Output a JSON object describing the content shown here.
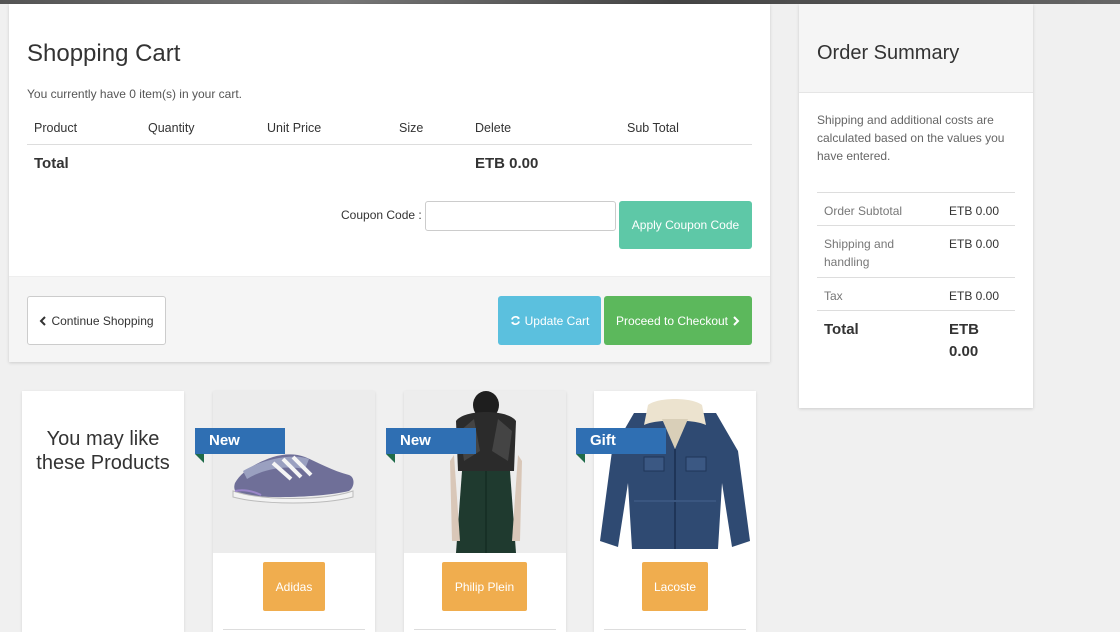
{
  "cart": {
    "title": "Shopping Cart",
    "note": "You currently have 0 item(s) in your cart.",
    "columns": [
      "Product",
      "Quantity",
      "Unit Price",
      "Size",
      "Delete",
      "Sub Total"
    ],
    "total_label": "Total",
    "total_value": "ETB 0.00",
    "coupon_label": "Coupon Code :",
    "coupon_placeholder": "",
    "apply_coupon_label": "Apply Coupon Code",
    "continue_label": "Continue Shopping",
    "update_label": "Update Cart",
    "checkout_label": "Proceed to Checkout"
  },
  "summary": {
    "title": "Order Summary",
    "note": "Shipping and additional costs are calculated based on the values you have entered.",
    "rows": [
      {
        "label": "Order Subtotal",
        "value": "ETB 0.00"
      },
      {
        "label": "Shipping and handling",
        "value": "ETB 0.00"
      },
      {
        "label": "Tax",
        "value": "ETB 0.00"
      }
    ],
    "total_label": "Total",
    "total_value": "ETB 0.00"
  },
  "recommend": {
    "heading": "You may like these Products",
    "products": [
      {
        "badge": "New",
        "brand": "Adidas",
        "image": "sneaker-image"
      },
      {
        "badge": "New",
        "brand": "Philip Plein",
        "image": "fur-vest-image"
      },
      {
        "badge": "Gift",
        "brand": "Lacoste",
        "image": "denim-jacket-image"
      }
    ]
  },
  "colors": {
    "apply_coupon": "#5ec8a7",
    "update": "#5bc0de",
    "checkout": "#5cb85c",
    "brand_button": "#f0ad4e",
    "ribbon": "#2f6fb3"
  }
}
